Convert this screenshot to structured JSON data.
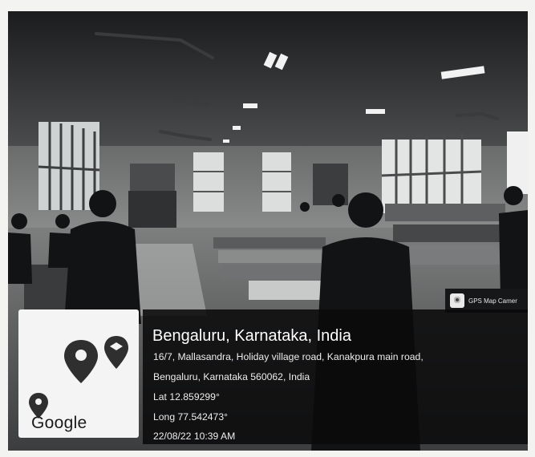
{
  "gps_badge": {
    "label": "GPS Map Camer",
    "icon": "gps-map-camera-icon"
  },
  "map": {
    "logo_text": "Google",
    "icons": [
      "map-pin-icon",
      "map-pin-small-icon",
      "map-pin-outline-icon"
    ]
  },
  "location": {
    "title": "Bengaluru, Karnataka, India",
    "address_line1": "16/7, Mallasandra, Holiday village road, Kanakpura main road,",
    "address_line2": "Bengaluru, Karnataka 560062, India",
    "latitude": "Lat 12.859299°",
    "longitude": "Long 77.542473°",
    "timestamp": "22/08/22 10:39 AM"
  }
}
